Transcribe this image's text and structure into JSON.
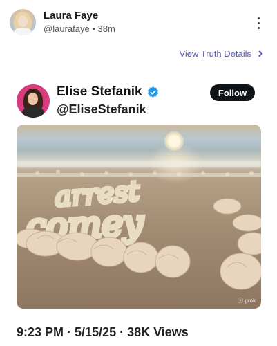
{
  "post": {
    "author_name": "Laura Faye",
    "author_handle": "@laurafaye",
    "separator": "•",
    "age": "38m",
    "more_icon": "kebab-vertical-icon",
    "details_link": "View Truth Details"
  },
  "quoted": {
    "name": "Elise Stefanik",
    "handle": "@EliseStefanik",
    "verified_icon": "verified-badge-icon",
    "follow_label": "Follow",
    "image_text": "arrest comey",
    "watermark": "ⓒ grok",
    "timestamp": "9:23 PM · 5/15/25 · ",
    "views": "38K Views"
  },
  "colors": {
    "link": "#5a5bb5",
    "verified": "#1d9bf0",
    "follow_bg": "#0f1419",
    "x_avatar_bg": "#d73c7e"
  }
}
